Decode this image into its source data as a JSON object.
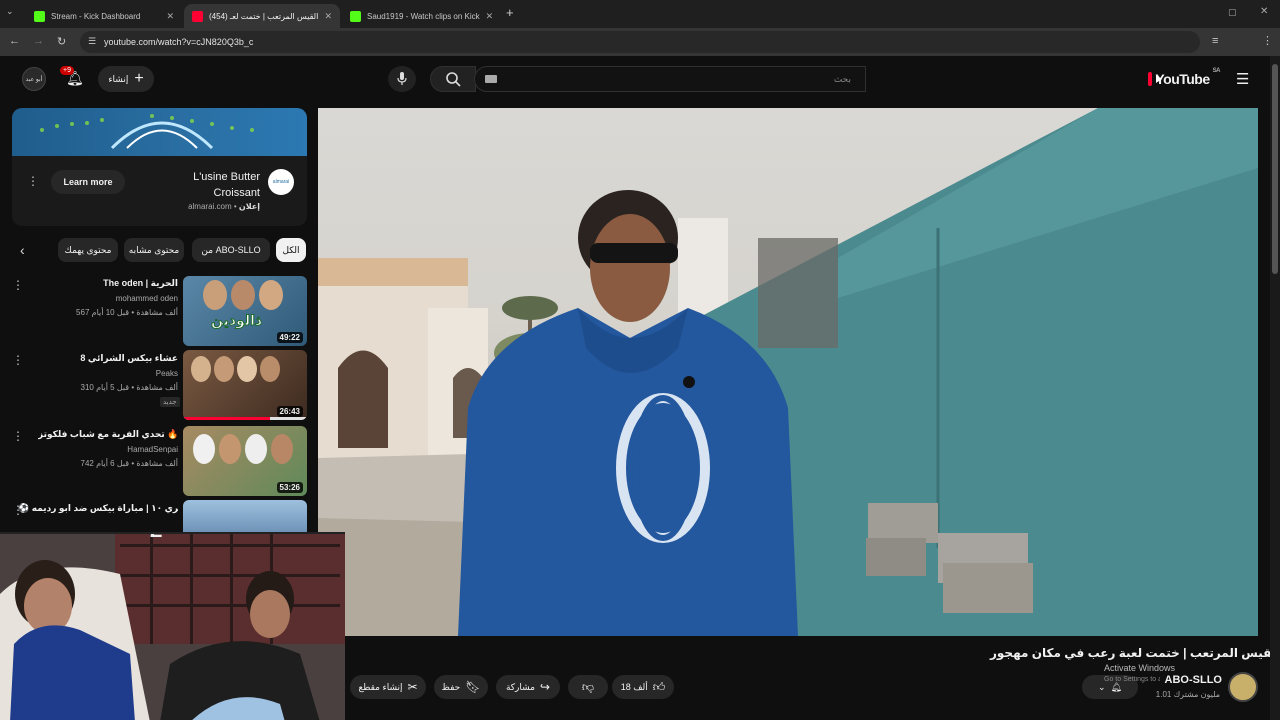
{
  "browser": {
    "tabs": [
      {
        "title": "Stream - Kick Dashboard",
        "favicon": "kick",
        "active": false
      },
      {
        "title": "(454) القيس المرتعب | ختمت لعـ",
        "favicon": "youtube",
        "active": true
      },
      {
        "title": "Saud1919 - Watch clips on Kick",
        "favicon": "kick",
        "active": false
      }
    ],
    "new_tab": "+",
    "url": "youtube.com/watch?v=cJN820Q3b_c"
  },
  "header": {
    "logo_text": "YouTube",
    "logo_region": "SA",
    "search_placeholder": "بحث",
    "create_label": "إنشاء",
    "notification_count": "+9",
    "avatar_label": "أبو عبد"
  },
  "ad": {
    "title": "L'usine Butter Croissant",
    "sponsor_label": "إعلان",
    "domain": "almarai.com",
    "cta": "Learn more",
    "brand_badge": "almarai"
  },
  "chips": [
    "الكل",
    "من ABO-SLLO",
    "محتوى مشابه",
    "محتوى يهمك"
  ],
  "videos": [
    {
      "title": "The oden | الحرية",
      "channel": "mohammed oden",
      "meta": "567 ألف مشاهدة • قبل 10 أيام",
      "duration": "49:22",
      "thumb_text": "ذالودين",
      "thumb_bg": "#4a6f8a"
    },
    {
      "title": "عشاء بيكس الشرائي 8",
      "channel": "Peaks",
      "meta": "310 ألف مشاهدة • قبل 5 أيام",
      "badge": "جديد",
      "duration": "26:43",
      "thumb_bg": "#6b4f3a"
    },
    {
      "title": "تحدي الفرية مع شباب فلكوتز 🔥💚",
      "channel": "HamadSenpai",
      "meta": "742 ألف مشاهدة • قبل 6 أيام",
      "duration": "53:26",
      "thumb_bg": "#8a6b4a"
    },
    {
      "title": "⚽ فري ١٠ | مباراة بيكس ضد ابو رديمه",
      "channel": "",
      "meta": "",
      "duration": "",
      "thumb_bg": "#7a98b8"
    }
  ],
  "video": {
    "title": "القيس المرتعب | ختمت لعبة رعب في مكان مهجور 😰 !",
    "channel": "ABO-SLLO",
    "subscribers": "1.01 مليون مشترك",
    "likes": "18 ألف",
    "share": "مشاركة",
    "save": "حفظ",
    "clip": "إنشاء مقطع",
    "watermark_line1": "Activate Windows",
    "watermark_line2": "Go to Settings to activate Windows."
  }
}
